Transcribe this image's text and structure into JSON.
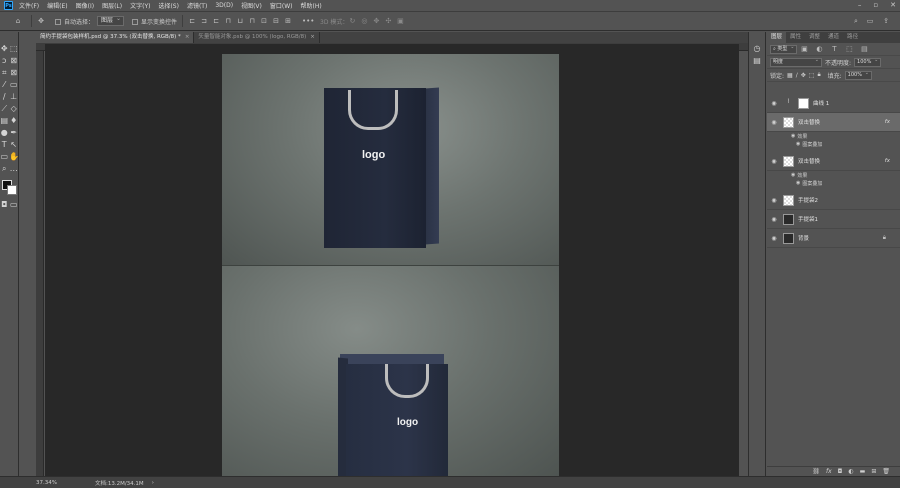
{
  "menu": {
    "app_icon": "Ps",
    "items": [
      "文件(F)",
      "编辑(E)",
      "图像(I)",
      "图层(L)",
      "文字(Y)",
      "选择(S)",
      "滤镜(T)",
      "3D(D)",
      "视图(V)",
      "窗口(W)",
      "帮助(H)"
    ]
  },
  "options": {
    "auto_select_label": "自动选择：",
    "auto_select_value": "图层",
    "show_transform_label": "显示变换控件",
    "mode_3d_label": "3D 模式："
  },
  "tabs": [
    {
      "label": "简约手提袋包装样机.psd @ 37.3% (双击替换, RGB/8) *",
      "close": "×"
    },
    {
      "label": "矢量智能对象.psb @ 100% (logo, RGB/8)",
      "close": "×"
    }
  ],
  "canvas": {
    "logo_top": "logo",
    "logo_bottom": "logo"
  },
  "status": {
    "zoom": "37.34%",
    "doc": "文档:13.2M/34.1M",
    "arrow": "›"
  },
  "panel": {
    "tabs": [
      "图层",
      "属性",
      "调整",
      "通道",
      "路径"
    ],
    "filter_kind": "类型",
    "blend_mode": "明度",
    "opacity_label": "不透明度:",
    "opacity_value": "100%",
    "lock_label": "锁定:",
    "fill_label": "填充:",
    "fill_value": "100%",
    "layers": [
      {
        "name": "曲线 1",
        "thumb": "white"
      },
      {
        "name": "双击替换",
        "fx": "fx",
        "effects_label": "效果",
        "effect": "图案叠加"
      },
      {
        "name": "双击替换",
        "fx": "fx",
        "effects_label": "效果",
        "effect": "图案叠加"
      },
      {
        "name": "手提袋2"
      },
      {
        "name": "手提袋1"
      },
      {
        "name": "背景"
      }
    ],
    "bottom_icons": [
      "link-icon",
      "fx-icon",
      "mask-icon",
      "adjustment-icon",
      "folder-icon",
      "new-layer-icon",
      "trash-icon"
    ]
  },
  "colors": {
    "bag": "#222a3b",
    "handle": "#bdbdbd",
    "scene": "#6d7470"
  }
}
